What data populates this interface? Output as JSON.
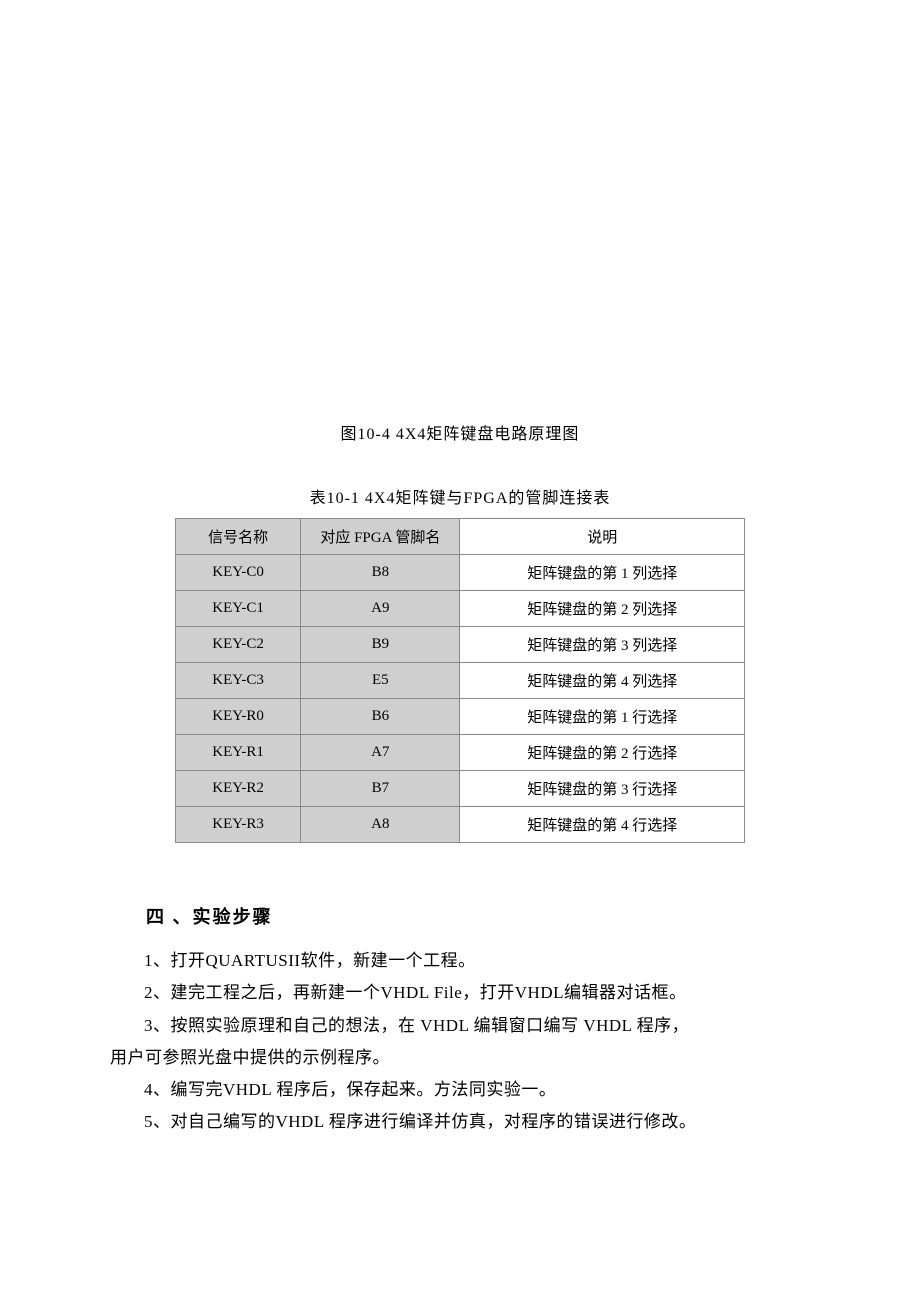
{
  "figure_caption": "图10-4  4X4矩阵键盘电路原理图",
  "table_caption": "表10-1  4X4矩阵键与FPGA的管脚连接表",
  "table": {
    "headers": {
      "col1": "信号名称",
      "col2": "对应 FPGA 管脚名",
      "col3": "说明"
    },
    "rows": [
      {
        "signal": "KEY-C0",
        "pin": "B8",
        "desc": "矩阵键盘的第 1 列选择"
      },
      {
        "signal": "KEY-C1",
        "pin": "A9",
        "desc": "矩阵键盘的第 2 列选择"
      },
      {
        "signal": "KEY-C2",
        "pin": "B9",
        "desc": "矩阵键盘的第 3 列选择"
      },
      {
        "signal": "KEY-C3",
        "pin": "E5",
        "desc": "矩阵键盘的第 4 列选择"
      },
      {
        "signal": "KEY-R0",
        "pin": "B6",
        "desc": "矩阵键盘的第 1 行选择"
      },
      {
        "signal": "KEY-R1",
        "pin": "A7",
        "desc": "矩阵键盘的第 2 行选择"
      },
      {
        "signal": "KEY-R2",
        "pin": "B7",
        "desc": "矩阵键盘的第 3 行选择"
      },
      {
        "signal": "KEY-R3",
        "pin": "A8",
        "desc": "矩阵键盘的第 4 行选择"
      }
    ]
  },
  "section_title": "四 、实验步骤",
  "steps": {
    "s1": "1、打开QUARTUSII软件，新建一个工程。",
    "s2": "2、建完工程之后，再新建一个VHDL File，打开VHDL编辑器对话框。",
    "s3a": "3、按照实验原理和自己的想法，在 VHDL 编辑窗口编写 VHDL 程序，",
    "s3b": "用户可参照光盘中提供的示例程序。",
    "s4": "4、编写完VHDL 程序后，保存起来。方法同实验一。",
    "s5": "5、对自己编写的VHDL 程序进行编译并仿真，对程序的错误进行修改。"
  }
}
